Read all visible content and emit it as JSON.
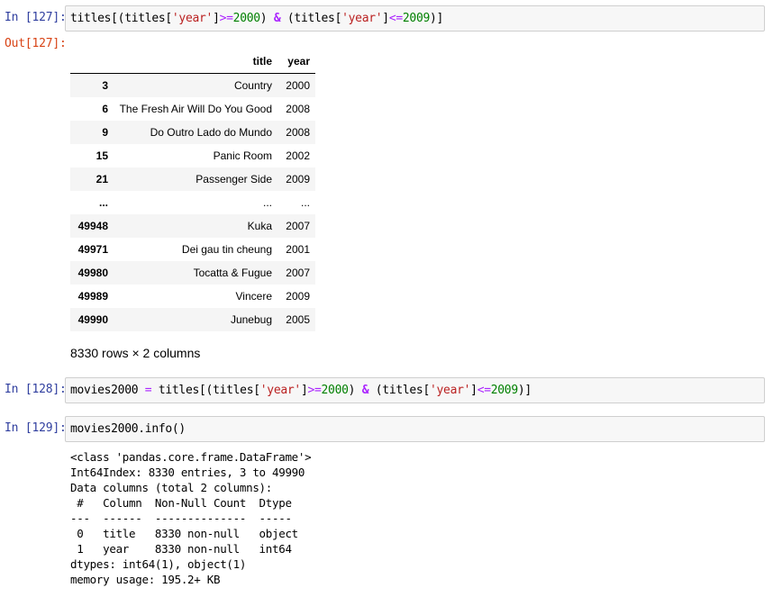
{
  "cells": [
    {
      "in_prompt": "In [127]:",
      "out_prompt": "Out[127]:",
      "code": {
        "p1": "titles[(titles[",
        "s1": "'year'",
        "p2": "]",
        "o1": ">=",
        "n1": "2000",
        "p3": ") ",
        "amp": "&",
        "p4": " (titles[",
        "s2": "'year'",
        "p5": "]",
        "o2": "<=",
        "n2": "2009",
        "p6": ")]"
      },
      "table": {
        "columns": [
          "title",
          "year"
        ],
        "rows": [
          {
            "idx": "3",
            "title": "Country",
            "year": "2000"
          },
          {
            "idx": "6",
            "title": "The Fresh Air Will Do You Good",
            "year": "2008"
          },
          {
            "idx": "9",
            "title": "Do Outro Lado do Mundo",
            "year": "2008"
          },
          {
            "idx": "15",
            "title": "Panic Room",
            "year": "2002"
          },
          {
            "idx": "21",
            "title": "Passenger Side",
            "year": "2009"
          },
          {
            "idx": "...",
            "title": "...",
            "year": "..."
          },
          {
            "idx": "49948",
            "title": "Kuka",
            "year": "2007"
          },
          {
            "idx": "49971",
            "title": "Dei gau tin cheung",
            "year": "2001"
          },
          {
            "idx": "49980",
            "title": "Tocatta & Fugue",
            "year": "2007"
          },
          {
            "idx": "49989",
            "title": "Vincere",
            "year": "2009"
          },
          {
            "idx": "49990",
            "title": "Junebug",
            "year": "2005"
          }
        ],
        "shape_text": "8330 rows × 2 columns"
      }
    },
    {
      "in_prompt": "In [128]:",
      "code": {
        "p1": "movies2000 ",
        "o0": "=",
        "p1b": " titles[(titles[",
        "s1": "'year'",
        "p2": "]",
        "o1": ">=",
        "n1": "2000",
        "p3": ") ",
        "amp": "&",
        "p4": " (titles[",
        "s2": "'year'",
        "p5": "]",
        "o2": "<=",
        "n2": "2009",
        "p6": ")]"
      }
    },
    {
      "in_prompt": "In [129]:",
      "code": {
        "p1": "movies2000.info()"
      },
      "stdout": "<class 'pandas.core.frame.DataFrame'>\nInt64Index: 8330 entries, 3 to 49990\nData columns (total 2 columns):\n #   Column  Non-Null Count  Dtype \n---  ------  --------------  ----- \n 0   title   8330 non-null   object\n 1   year    8330 non-null   int64 \ndtypes: int64(1), object(1)\nmemory usage: 195.2+ KB"
    }
  ]
}
